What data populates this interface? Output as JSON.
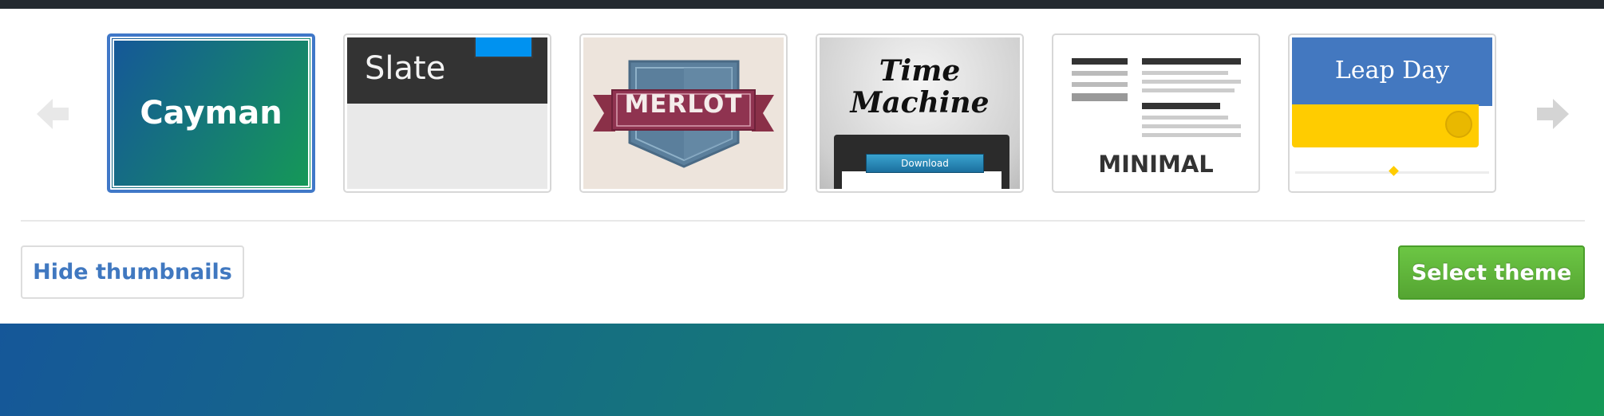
{
  "carousel": {
    "prev_icon": "arrow-left-icon",
    "next_icon": "arrow-right-icon",
    "themes": [
      {
        "name": "Cayman",
        "selected": true
      },
      {
        "name": "Slate",
        "selected": false
      },
      {
        "name": "MERLOT",
        "selected": false
      },
      {
        "name": "Time\nMachine",
        "button_label": "Download",
        "selected": false
      },
      {
        "name": "MINIMAL",
        "selected": false
      },
      {
        "name": "Leap Day",
        "selected": false
      }
    ]
  },
  "actions": {
    "hide_thumbnails_label": "Hide thumbnails",
    "select_theme_label": "Select theme"
  },
  "colors": {
    "accent_blue": "#4078c8",
    "select_green": "#6cc644",
    "cayman_gradient_start": "#155799",
    "cayman_gradient_end": "#159957",
    "top_bar": "#242a30"
  }
}
